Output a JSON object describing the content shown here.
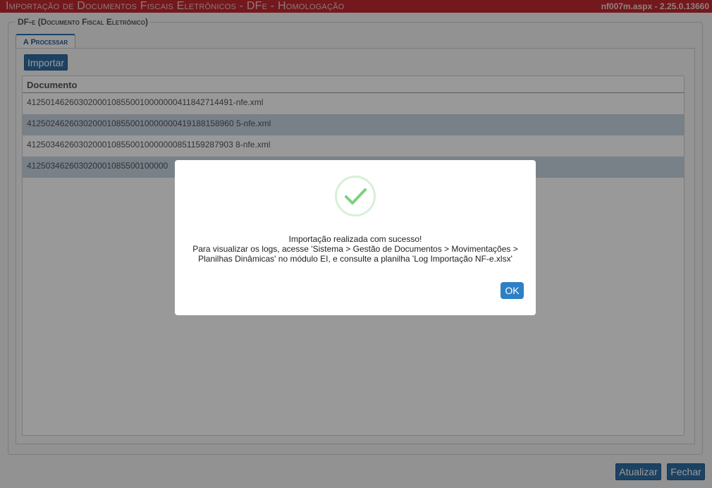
{
  "window": {
    "title": "Importação de Documentos Fiscais Eletrônicos - DFe  - Homologação",
    "version": "nf007m.aspx - 2.25.0.13660"
  },
  "fieldset": {
    "legend": "DF-e (Documento Fiscal Eletrônico)"
  },
  "tabs": [
    {
      "label": "A Processar",
      "active": true
    }
  ],
  "toolbar": {
    "import_label": "Importar"
  },
  "grid": {
    "columns": [
      "Documento"
    ],
    "rows": [
      "41250146260302000108550010000000411842714491-nfe.xml",
      "41250246260302000108550010000000419188158960 5-nfe.xml",
      "41250346260302000108550010000000851159287903 8-nfe.xml",
      "412503462603020001085500100000"
    ]
  },
  "modal": {
    "icon": "success-check-icon",
    "message_line1": "Importação realizada com sucesso!",
    "message_line2": "Para visualizar os logs, acesse 'Sistema > Gestão de Documentos > Movimentações > Planilhas Dinâmicas' no módulo EI, e consulte a planilha 'Log Importação NF-e.xlsx'",
    "ok_label": "OK"
  },
  "footer": {
    "refresh_label": "Atualizar",
    "close_label": "Fechar"
  },
  "colors": {
    "titlebar": "#c0282f",
    "primary_button": "#2f6ea6",
    "ok_button": "#2f7fc4",
    "success_check": "#7fd17f",
    "row_alt": "#c9d6e3"
  }
}
